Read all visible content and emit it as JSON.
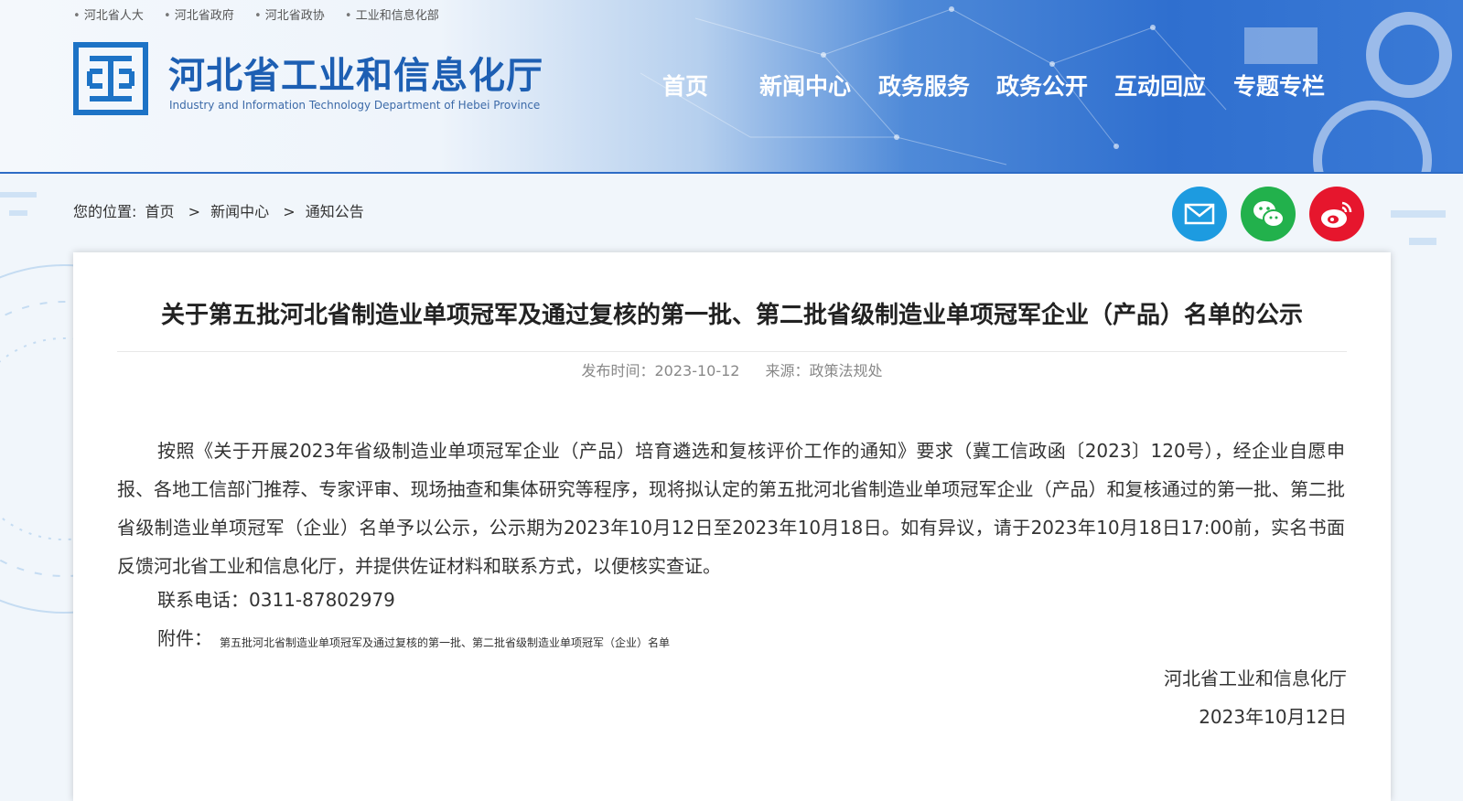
{
  "top_links": [
    "河北省人大",
    "河北省政府",
    "河北省政协",
    "工业和信息化部"
  ],
  "site": {
    "title": "河北省工业和信息化厅",
    "subtitle": "Industry and Information Technology Department of Hebei Province"
  },
  "nav": [
    "首页",
    "新闻中心",
    "政务服务",
    "政务公开",
    "互动回应",
    "专题专栏"
  ],
  "breadcrumb": {
    "label": "您的位置:",
    "items": [
      "首页",
      "新闻中心",
      "通知公告"
    ],
    "separator": ">"
  },
  "share_icons": [
    "mail-icon",
    "wechat-icon",
    "weibo-icon"
  ],
  "colors": {
    "brand_blue": "#1d5fb3",
    "mail": "#1d9be0",
    "wechat": "#22b14c",
    "weibo": "#e6162d"
  },
  "article": {
    "title": "关于第五批河北省制造业单项冠军及通过复核的第一批、第二批省级制造业单项冠军企业（产品）名单的公示",
    "publish_label": "发布时间：2023-10-12",
    "source_label": "来源：政策法规处",
    "body": "按照《关于开展2023年省级制造业单项冠军企业（产品）培育遴选和复核评价工作的通知》要求（冀工信政函〔2023〕120号），经企业自愿申报、各地工信部门推荐、专家评审、现场抽查和集体研究等程序，现将拟认定的第五批河北省制造业单项冠军企业（产品）和复核通过的第一批、第二批省级制造业单项冠军（企业）名单予以公示，公示期为2023年10月12日至2023年10月18日。如有异议，请于2023年10月18日17:00前，实名书面反馈河北省工业和信息化厅，并提供佐证材料和联系方式，以便核实查证。",
    "contact": "联系电话：0311-87802979",
    "attachment_label": "附件：",
    "attachment_link": "第五批河北省制造业单项冠军及通过复核的第一批、第二批省级制造业单项冠军（企业）名单",
    "signature": "河北省工业和信息化厅",
    "date": "2023年10月12日"
  }
}
